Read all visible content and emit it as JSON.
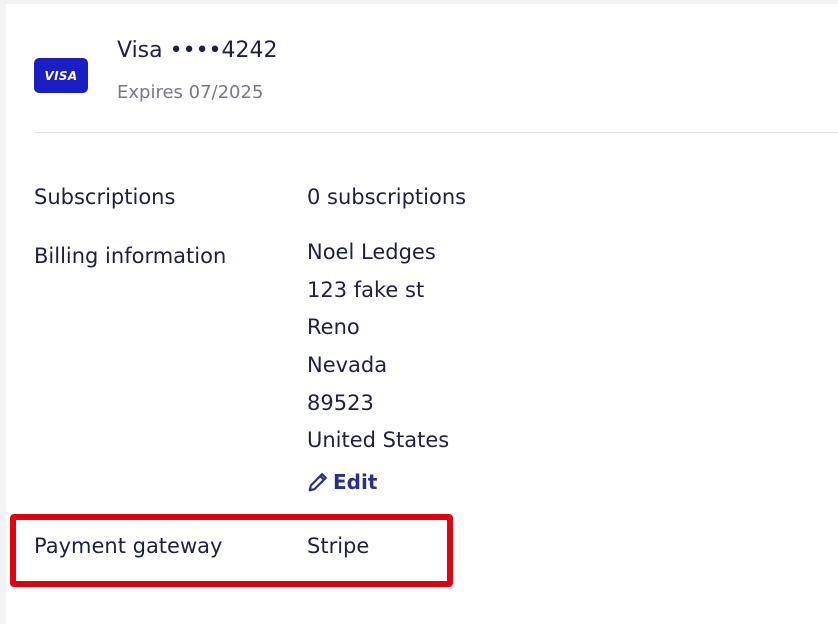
{
  "card": {
    "brand_logo_text": "VISA",
    "title": "Visa ••••4242",
    "expiry": "Expires 07/2025"
  },
  "subscriptions": {
    "label": "Subscriptions",
    "value": "0 subscriptions"
  },
  "billing": {
    "label": "Billing information",
    "address_lines": [
      "Noel Ledges",
      "123 fake st",
      "Reno",
      "Nevada",
      "89523",
      "United States"
    ],
    "edit_label": "Edit"
  },
  "gateway": {
    "label": "Payment gateway",
    "value": "Stripe"
  },
  "colors": {
    "brand_blue": "#1a1fc4",
    "text_navy": "#1f1f46",
    "link": "#2a2f8c",
    "highlight_red": "#e3000f"
  },
  "icons": {
    "edit": "pencil-icon"
  }
}
